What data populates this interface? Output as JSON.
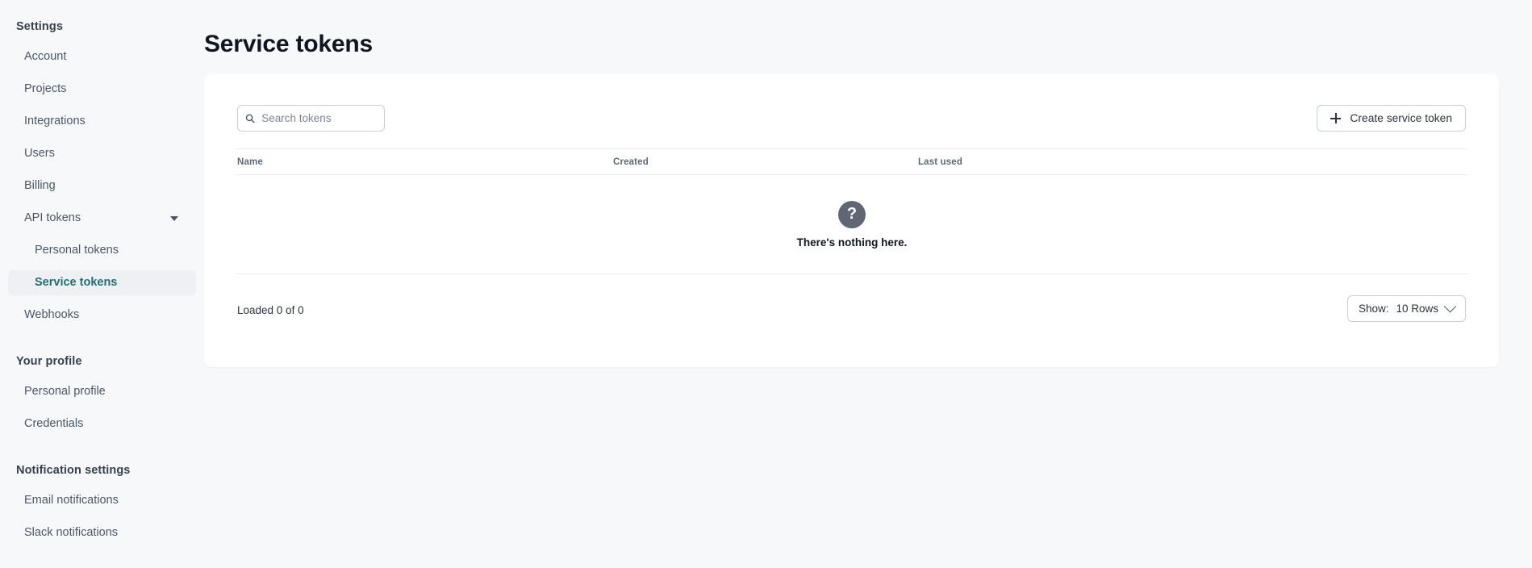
{
  "sidebar": {
    "settings_heading": "Settings",
    "settings_items": [
      {
        "label": "Account",
        "level": "top",
        "state": "normal"
      },
      {
        "label": "Projects",
        "level": "top",
        "state": "normal"
      },
      {
        "label": "Integrations",
        "level": "top",
        "state": "normal"
      },
      {
        "label": "Users",
        "level": "top",
        "state": "normal"
      },
      {
        "label": "Billing",
        "level": "top",
        "state": "normal"
      },
      {
        "label": "API tokens",
        "level": "top",
        "state": "expanded",
        "icon": "caret-down-icon"
      },
      {
        "label": "Personal tokens",
        "level": "sub",
        "state": "normal"
      },
      {
        "label": "Service tokens",
        "level": "sub",
        "state": "active"
      },
      {
        "label": "Webhooks",
        "level": "top",
        "state": "normal"
      }
    ],
    "profile_heading": "Your profile",
    "profile_items": [
      {
        "label": "Personal profile"
      },
      {
        "label": "Credentials"
      }
    ],
    "notifications_heading": "Notification settings",
    "notification_items": [
      {
        "label": "Email notifications"
      },
      {
        "label": "Slack notifications"
      }
    ],
    "active_color": "#1f6f73",
    "active_bg": "#eef0f3"
  },
  "main": {
    "page_title": "Service tokens",
    "search": {
      "placeholder": "Search tokens",
      "value": "",
      "icon": "search-icon"
    },
    "create_button": {
      "label": "Create service token",
      "icon": "plus-icon"
    },
    "table": {
      "columns": [
        "Name",
        "Created",
        "Last used"
      ],
      "rows": [],
      "empty_state": {
        "icon": "question-mark-icon",
        "message": "There's nothing here."
      }
    },
    "footer": {
      "loaded_text": "Loaded 0 of 0",
      "show_label": "Show:",
      "show_value": "10 Rows",
      "chevron_icon": "chevron-down-icon"
    }
  },
  "theme": {
    "page_bg": "#f7f8fa",
    "card_bg": "#ffffff",
    "border": "#e7e9ed",
    "text": "#2b3240",
    "muted": "#5f6775",
    "accent": "#1f6f73"
  }
}
